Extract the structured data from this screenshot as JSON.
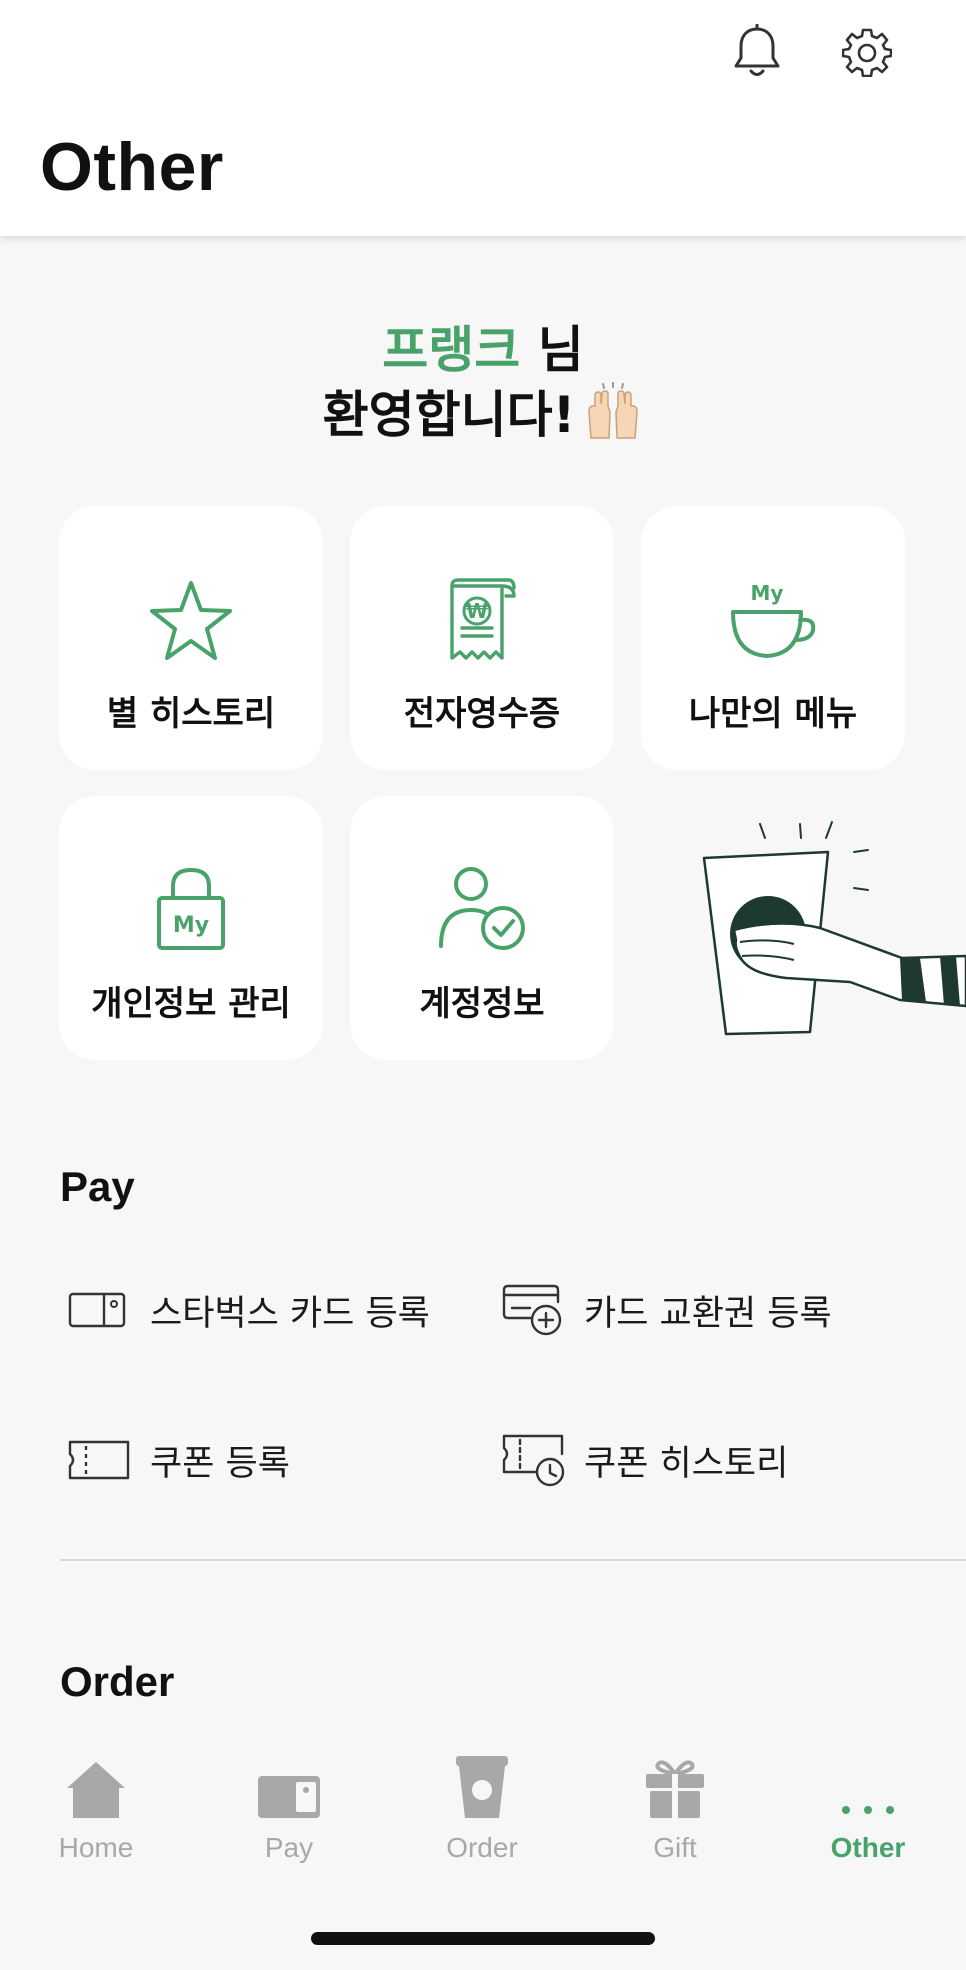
{
  "header": {
    "title": "Other",
    "icons": [
      "bell-icon",
      "gear-icon"
    ]
  },
  "welcome": {
    "name": "프랭크",
    "honorific": " 님",
    "line2": "환영합니다!"
  },
  "tiles": [
    {
      "label": "별 히스토리",
      "icon": "star-icon"
    },
    {
      "label": "전자영수증",
      "icon": "receipt-icon"
    },
    {
      "label": "나만의 메뉴",
      "icon": "my-cup-icon",
      "badge": "My"
    },
    {
      "label": "개인정보 관리",
      "icon": "lock-icon",
      "badge": "My"
    },
    {
      "label": "계정정보",
      "icon": "user-check-icon"
    }
  ],
  "receipt_symbol": "₩",
  "pay": {
    "title": "Pay",
    "items": [
      {
        "label": "스타벅스 카드 등록",
        "icon": "card-icon"
      },
      {
        "label": "카드 교환권 등록",
        "icon": "card-add-icon"
      },
      {
        "label": "쿠폰 등록",
        "icon": "coupon-icon"
      },
      {
        "label": "쿠폰 히스토리",
        "icon": "coupon-history-icon"
      }
    ]
  },
  "order": {
    "title": "Order"
  },
  "tabbar": {
    "active": "Other",
    "tabs": [
      {
        "label": "Home",
        "icon": "home-icon"
      },
      {
        "label": "Pay",
        "icon": "wallet-icon"
      },
      {
        "label": "Order",
        "icon": "cup-icon"
      },
      {
        "label": "Gift",
        "icon": "gift-icon"
      },
      {
        "label": "Other",
        "icon": "more-icon"
      }
    ]
  },
  "colors": {
    "accent": "#4aa26b",
    "tab_inactive": "#a8a8a8",
    "background": "#f7f7f7"
  }
}
